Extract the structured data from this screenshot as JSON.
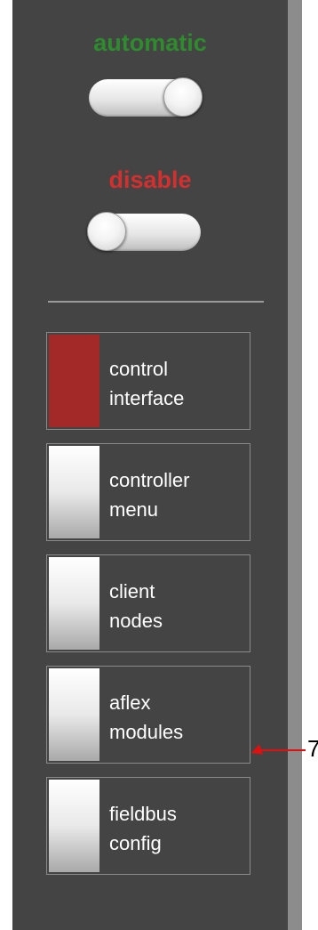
{
  "modes": {
    "automatic": {
      "label": "automatic",
      "color": "#2e8b2e",
      "state": "on"
    },
    "disable": {
      "label": "disable",
      "color": "#d32f2f",
      "state": "off"
    }
  },
  "menu": {
    "items": [
      {
        "line1": "control",
        "line2": "interface",
        "active": true
      },
      {
        "line1": "controller",
        "line2": "menu",
        "active": false
      },
      {
        "line1": "client",
        "line2": "nodes",
        "active": false
      },
      {
        "line1": "aflex",
        "line2": "modules",
        "active": false
      },
      {
        "line1": "fieldbus",
        "line2": "config",
        "active": false
      }
    ]
  },
  "annotation": {
    "number": "7",
    "color": "#e01010"
  },
  "colors": {
    "panel": "#444444",
    "scrollbar": "#8c8c8c",
    "active_swatch": "#a32929"
  }
}
